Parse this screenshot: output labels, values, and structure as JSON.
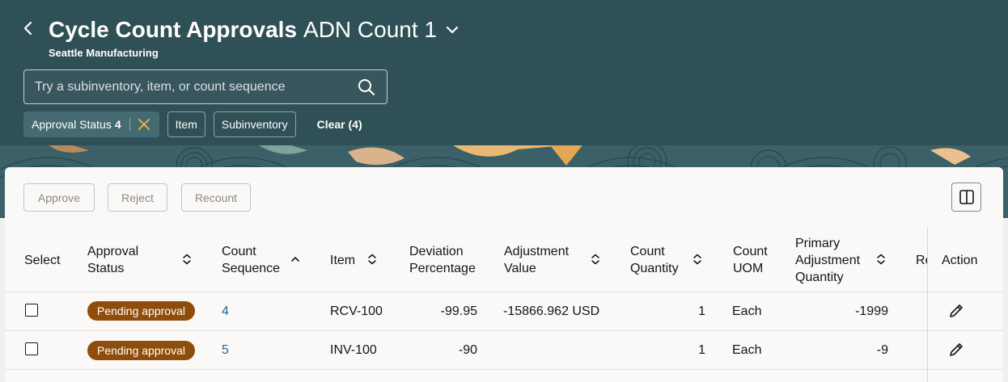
{
  "header": {
    "title": "Cycle Count Approvals",
    "count_name": "ADN Count 1",
    "organization": "Seattle Manufacturing"
  },
  "search": {
    "placeholder": "Try a subinventory, item, or count sequence"
  },
  "filters": {
    "approval_status_label": "Approval Status",
    "approval_status_count": "4",
    "item_label": "Item",
    "subinventory_label": "Subinventory",
    "clear_label": "Clear (4)"
  },
  "toolbar": {
    "approve": "Approve",
    "reject": "Reject",
    "recount": "Recount"
  },
  "table": {
    "headers": {
      "select": "Select",
      "approval_status": [
        "Approval",
        "Status"
      ],
      "count_sequence": [
        "Count",
        "Sequence"
      ],
      "item": "Item",
      "deviation_percentage": [
        "Deviation",
        "Percentage"
      ],
      "adjustment_value": [
        "Adjustment",
        "Value"
      ],
      "count_quantity": [
        "Count",
        "Quantity"
      ],
      "count_uom": [
        "Count",
        "UOM"
      ],
      "primary_adjustment_quantity": [
        "Primary",
        "Adjustment",
        "Quantity"
      ],
      "truncated": "Re",
      "action": "Action"
    },
    "rows": [
      {
        "status": "Pending approval",
        "sequence": "4",
        "item": "RCV-100",
        "deviation": "-99.95",
        "adjustment_value": "-15866.962 USD",
        "count_quantity": "1",
        "uom": "Each",
        "primary_adjustment": "-1999"
      },
      {
        "status": "Pending approval",
        "sequence": "5",
        "item": "INV-100",
        "deviation": "-90",
        "adjustment_value": "",
        "count_quantity": "1",
        "uom": "Each",
        "primary_adjustment": "-9"
      }
    ]
  },
  "colors": {
    "header_bg": "#2f5057",
    "status_badge": "#8f4d0b",
    "link": "#1e6a8a",
    "filter_close": "#e6a94b"
  },
  "icons": [
    "back-chevron-icon",
    "chevron-down-icon",
    "search-icon",
    "close-icon",
    "column-panel-icon",
    "sort-icon",
    "edit-pencil-icon"
  ]
}
